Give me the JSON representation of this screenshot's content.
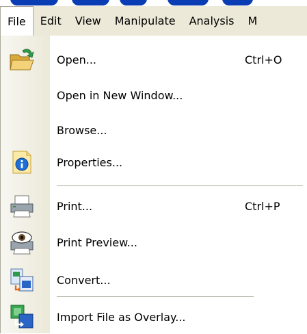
{
  "menubar": {
    "items": [
      "File",
      "Edit",
      "View",
      "Manipulate",
      "Analysis",
      "M"
    ]
  },
  "file_menu": {
    "items": [
      {
        "label": "Open...",
        "shortcut": "Ctrl+O",
        "icon": "open-folder-icon"
      },
      {
        "label": "Open in New Window...",
        "shortcut": "",
        "icon": ""
      },
      {
        "label": "Browse...",
        "shortcut": "",
        "icon": ""
      },
      {
        "label": "Properties...",
        "shortcut": "",
        "icon": "info-properties-icon"
      },
      {
        "label": "Print...",
        "shortcut": "Ctrl+P",
        "icon": "printer-icon"
      },
      {
        "label": "Print Preview...",
        "shortcut": "",
        "icon": "print-preview-icon"
      },
      {
        "label": "Convert...",
        "shortcut": "",
        "icon": "convert-icon"
      },
      {
        "label": "Import File as Overlay...",
        "shortcut": "",
        "icon": "import-overlay-icon"
      }
    ]
  },
  "colors": {
    "menubar_bg": "#ece9d8",
    "gutter": "#ece9d8",
    "title_blue": "#0a3cb4"
  }
}
